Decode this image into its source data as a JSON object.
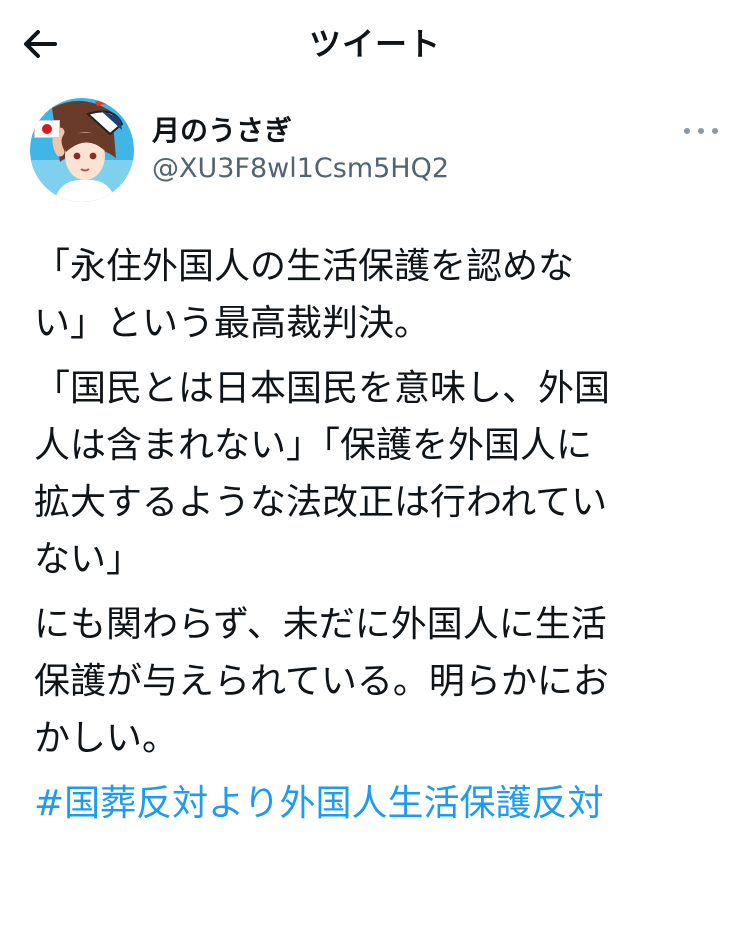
{
  "header": {
    "title": "ツイート",
    "back_icon": "arrow-left-icon"
  },
  "author": {
    "display_name": "月のうさぎ",
    "handle": "@XU3F8wl1Csm5HQ2",
    "avatar_flag": "japan-flag",
    "more_icon": "more-dots-icon"
  },
  "tweet": {
    "paragraphs": [
      "「永住外国人の生活保護を認めな\nい」という最高裁判決。",
      "「国民とは日本国民を意味し、外国\n人は含まれない」「保護を外国人に\n拡大するような法改正は行われてい\nない」",
      "にも関わらず、未だに外国人に生活\n保護が与えられている。明らかにお\nかしい。"
    ],
    "hashtag": "#国葬反対より外国人生活保護反対"
  },
  "colors": {
    "text": "#0f1419",
    "secondary": "#536471",
    "link": "#1d9bf0"
  }
}
